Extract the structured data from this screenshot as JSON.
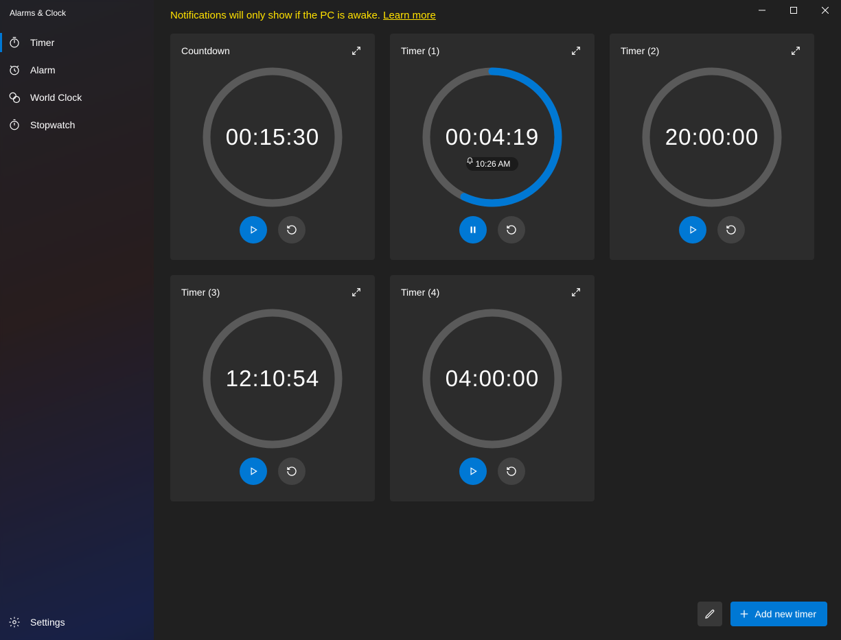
{
  "app_title": "Alarms & Clock",
  "window_controls": {
    "minimize": "minimize",
    "maximize": "maximize",
    "close": "close"
  },
  "sidebar": {
    "items": [
      {
        "label": "Timer",
        "icon": "timer",
        "active": true
      },
      {
        "label": "Alarm",
        "icon": "alarm",
        "active": false
      },
      {
        "label": "World Clock",
        "icon": "worldclock",
        "active": false
      },
      {
        "label": "Stopwatch",
        "icon": "stopwatch",
        "active": false
      }
    ],
    "settings_label": "Settings"
  },
  "notification": {
    "text": "Notifications will only show if the PC is awake. ",
    "link": "Learn more"
  },
  "accent": "#0078d4",
  "timers": [
    {
      "name": "Countdown",
      "time": "00:15:30",
      "state": "stopped",
      "progress": 0,
      "bell": null
    },
    {
      "name": "Timer (1)",
      "time": "00:04:19",
      "state": "running",
      "progress": 0.57,
      "bell": "10:26 AM"
    },
    {
      "name": "Timer (2)",
      "time": "20:00:00",
      "state": "stopped",
      "progress": 0,
      "bell": null
    },
    {
      "name": "Timer (3)",
      "time": "12:10:54",
      "state": "stopped",
      "progress": 0,
      "bell": null
    },
    {
      "name": "Timer (4)",
      "time": "04:00:00",
      "state": "stopped",
      "progress": 0,
      "bell": null
    }
  ],
  "bottom": {
    "edit_label": "Edit timers",
    "add_label": "Add new timer"
  }
}
